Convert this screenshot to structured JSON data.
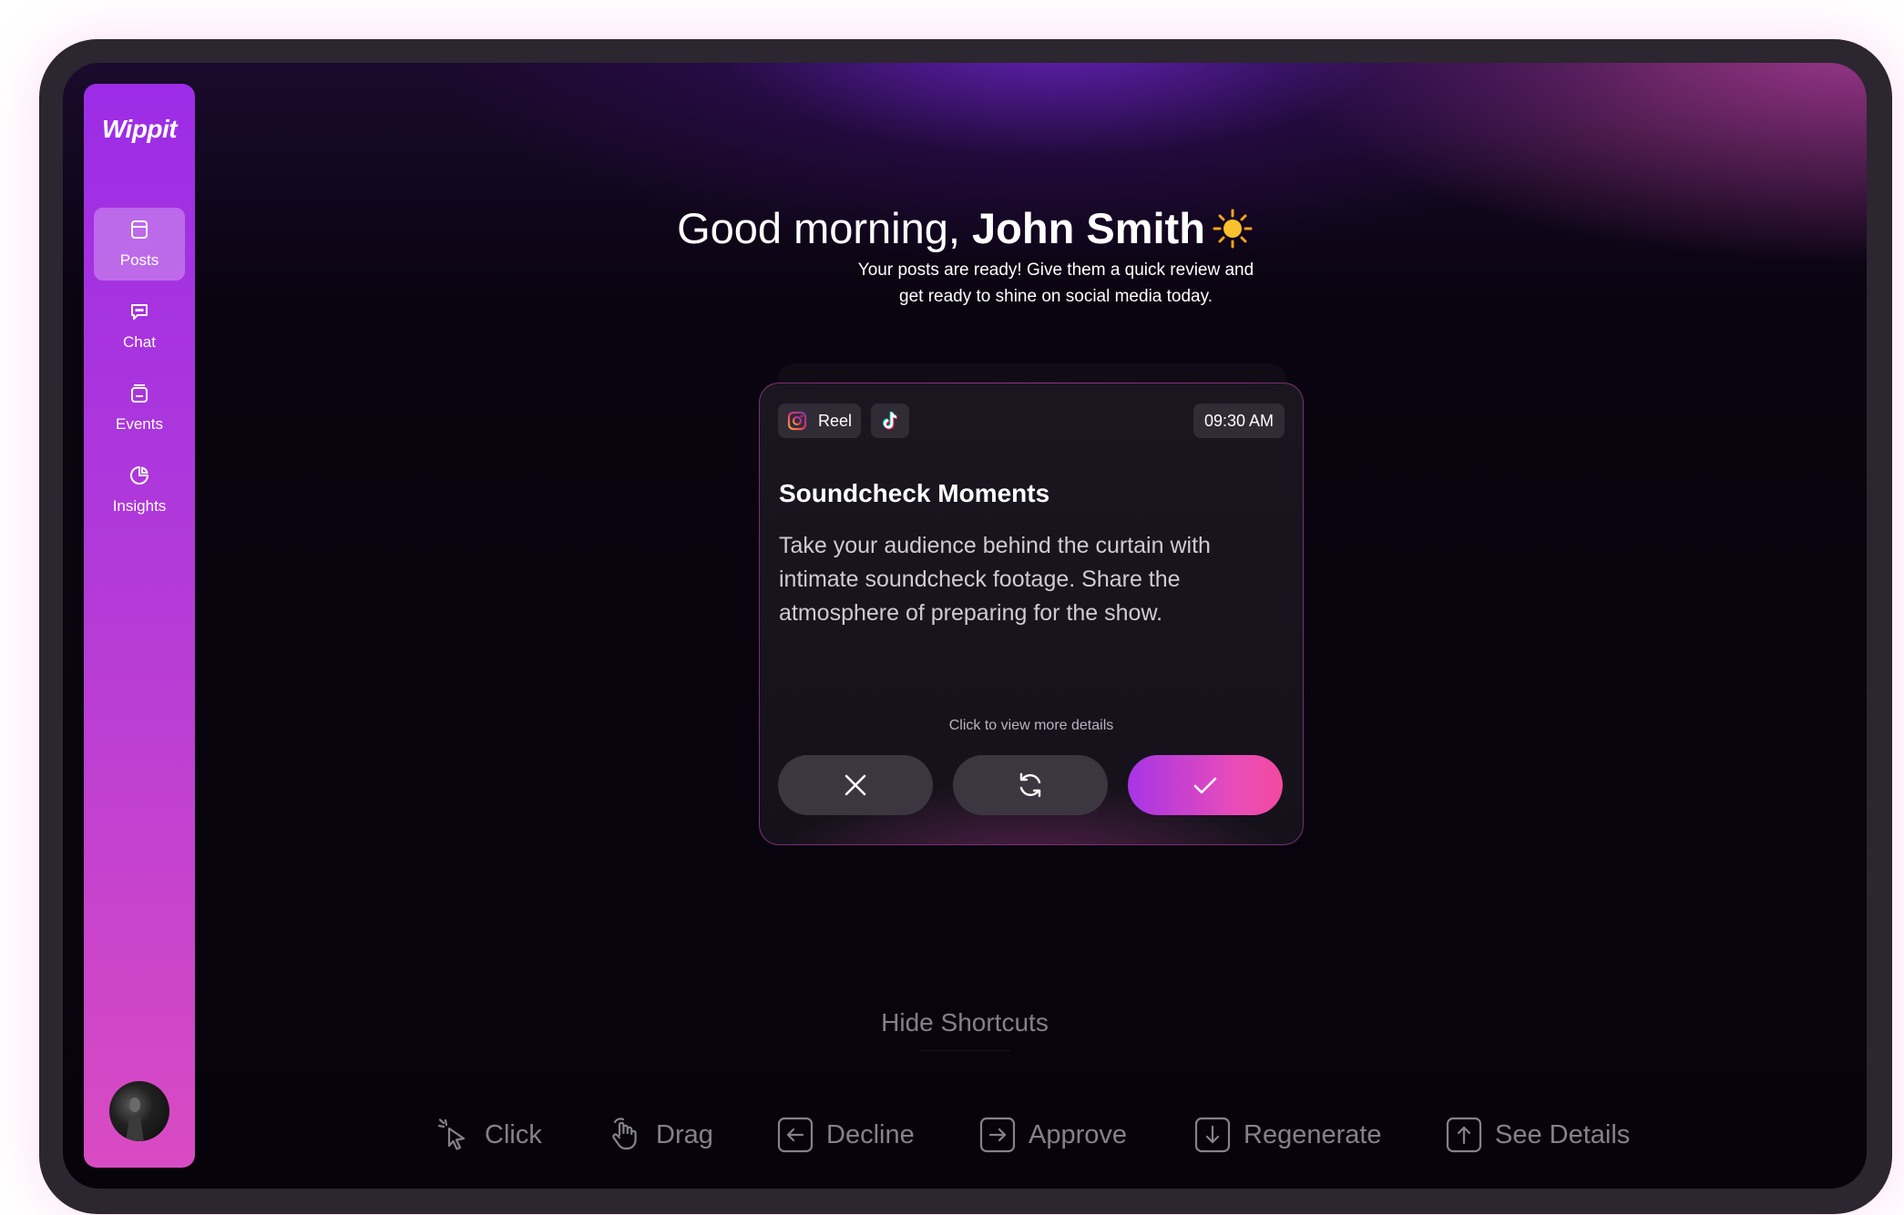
{
  "sidebar": {
    "logo": "Wippit",
    "items": [
      {
        "label": "Posts",
        "icon": "posts-icon",
        "active": true
      },
      {
        "label": "Chat",
        "icon": "chat-icon",
        "active": false
      },
      {
        "label": "Events",
        "icon": "events-icon",
        "active": false
      },
      {
        "label": "Insights",
        "icon": "insights-icon",
        "active": false
      }
    ],
    "avatar": "user-avatar"
  },
  "greeting": {
    "prefix": "Good morning,",
    "name": "John Smith",
    "icon": "sun-icon",
    "line1": "Your posts are ready! Give them a quick review and",
    "line2": "get ready to shine on social media today."
  },
  "card": {
    "platform_tag": "Reel",
    "platform_icons": [
      "instagram-icon",
      "tiktok-icon"
    ],
    "time": "09:30 AM",
    "title": "Soundcheck Moments",
    "body_lines": [
      "Take your audience behind the curtain with",
      "intimate soundcheck footage. Share the",
      "atmosphere of preparing for the show."
    ],
    "hint": "Click to view more details",
    "actions": [
      "decline",
      "regenerate",
      "approve"
    ]
  },
  "shortcuts": {
    "toggle_label": "Hide Shortcuts",
    "items": [
      {
        "label": "Click",
        "icon": "pointer-click-icon"
      },
      {
        "label": "Drag",
        "icon": "hand-drag-icon"
      },
      {
        "label": "Decline",
        "icon": "arrow-left-key-icon"
      },
      {
        "label": "Approve",
        "icon": "arrow-right-key-icon"
      },
      {
        "label": "Regenerate",
        "icon": "arrow-down-key-icon"
      },
      {
        "label": "See Details",
        "icon": "arrow-up-key-icon"
      }
    ]
  },
  "colors": {
    "accent_purple": "#9c2ce6",
    "accent_pink": "#e94cb8",
    "background": "#07030b"
  }
}
